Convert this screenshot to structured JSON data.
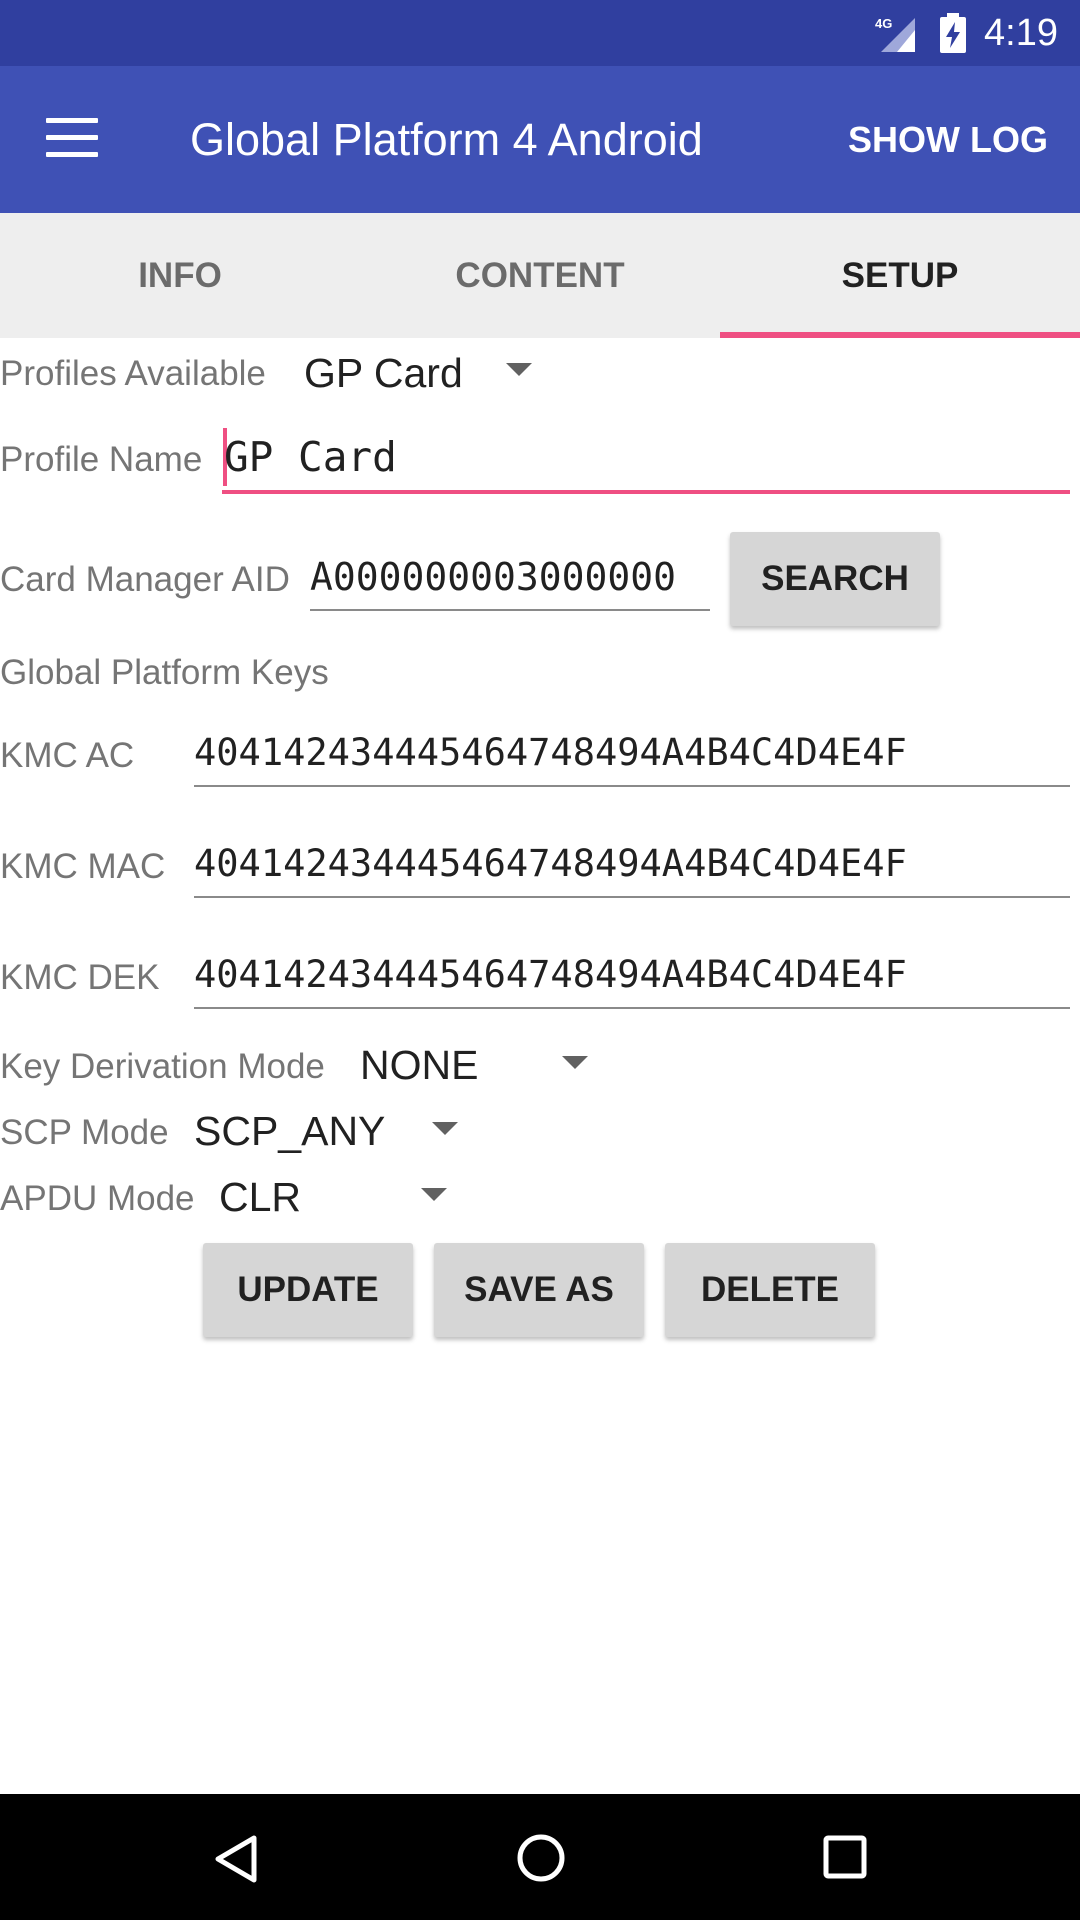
{
  "status_bar": {
    "network": "4G",
    "time": "4:19"
  },
  "app_bar": {
    "title": "Global Platform 4 Android",
    "action": "SHOW LOG"
  },
  "tabs": [
    {
      "label": "INFO",
      "selected": false
    },
    {
      "label": "CONTENT",
      "selected": false
    },
    {
      "label": "SETUP",
      "selected": true
    }
  ],
  "setup": {
    "profiles_label": "Profiles Available",
    "profiles_value": "GP Card",
    "profile_name_label": "Profile Name",
    "profile_name_value": "GP Card",
    "card_manager_label": "Card Manager AID",
    "card_manager_value": "A000000003000000",
    "search_label": "SEARCH",
    "keys_heading": "Global Platform Keys",
    "kmc_ac_label": "KMC AC",
    "kmc_ac_value": "404142434445464748494A4B4C4D4E4F",
    "kmc_mac_label": "KMC MAC",
    "kmc_mac_value": "404142434445464748494A4B4C4D4E4F",
    "kmc_dek_label": "KMC DEK",
    "kmc_dek_value": "404142434445464748494A4B4C4D4E4F",
    "key_derivation_label": "Key Derivation Mode",
    "key_derivation_value": "NONE",
    "scp_mode_label": "SCP Mode",
    "scp_mode_value": "SCP_ANY",
    "apdu_mode_label": "APDU Mode",
    "apdu_mode_value": "CLR"
  },
  "actions": {
    "update": "UPDATE",
    "save_as": "SAVE AS",
    "delete": "DELETE"
  },
  "colors": {
    "primary": "#3f51b5",
    "primary_dark": "#303f9f",
    "accent": "#ef4f82"
  }
}
